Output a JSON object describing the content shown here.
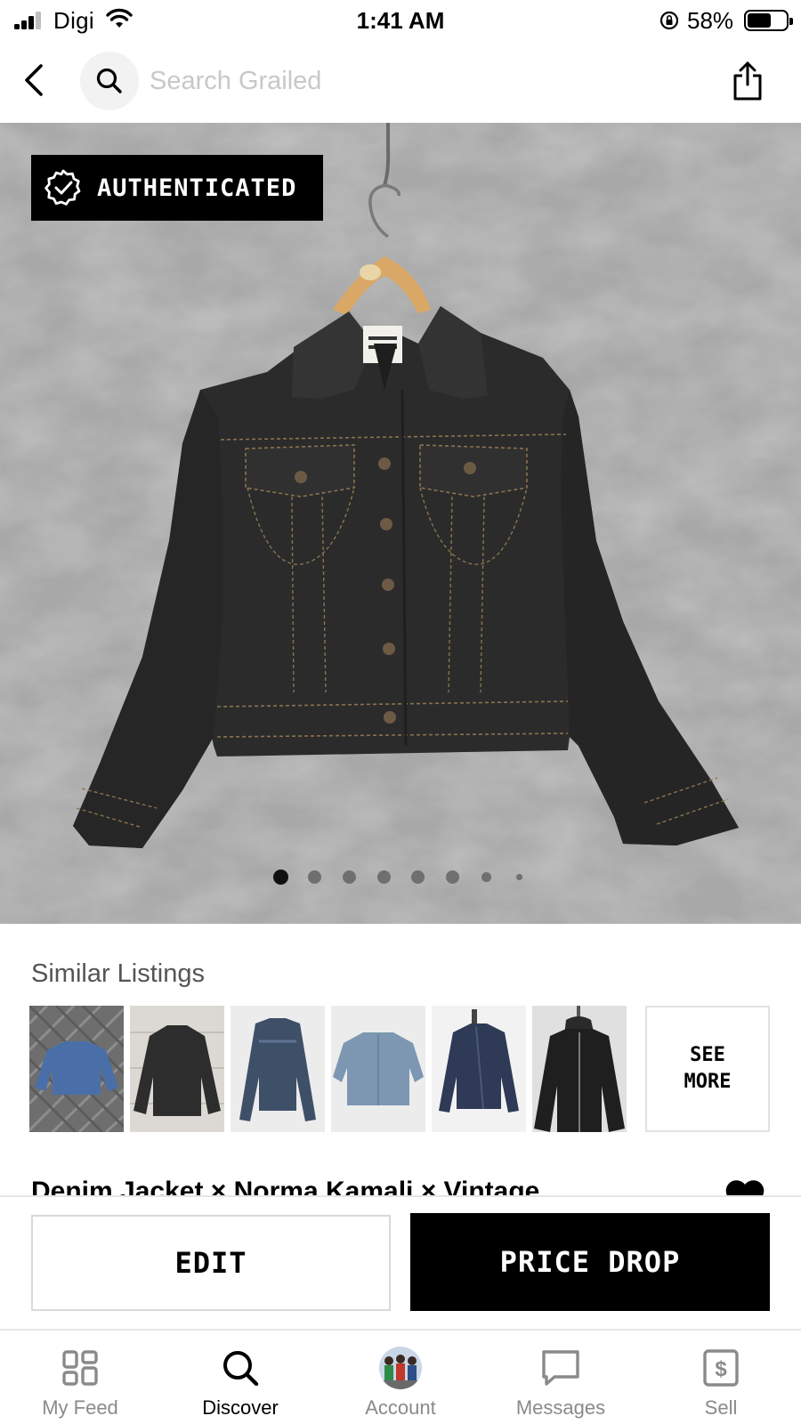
{
  "status_bar": {
    "carrier": "Digi",
    "time": "1:41 AM",
    "battery_percent": "58%",
    "battery_level": 0.58
  },
  "search": {
    "placeholder": "Search Grailed"
  },
  "hero": {
    "badge_label": "AUTHENTICATED",
    "image_count": 8,
    "active_image_index": 0
  },
  "similar": {
    "title": "Similar Listings",
    "see_more_label": "SEE\nMORE"
  },
  "listing": {
    "title": "Denim Jacket × Norma Kamali × Vintage"
  },
  "actions": {
    "edit_label": "EDIT",
    "price_drop_label": "PRICE DROP"
  },
  "tabs": [
    {
      "label": "My Feed",
      "icon": "grid-icon",
      "active": false
    },
    {
      "label": "Discover",
      "icon": "search-icon",
      "active": true
    },
    {
      "label": "Account",
      "icon": "avatar",
      "active": false
    },
    {
      "label": "Messages",
      "icon": "chat-bubble-icon",
      "active": false
    },
    {
      "label": "Sell",
      "icon": "dollar-tag-icon",
      "active": false
    }
  ],
  "colors": {
    "primary": "#000000",
    "inactive_tab": "#8a8a8a",
    "hero_background": "#a4a4a4"
  }
}
